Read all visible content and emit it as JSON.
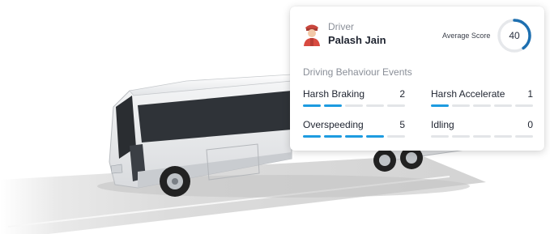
{
  "driver": {
    "label": "Driver",
    "name": "Palash Jain",
    "avatar_icon": "driver-avatar-icon"
  },
  "score": {
    "label": "Average Score",
    "value": "40",
    "fraction": 0.4,
    "ring_color": "#1d6fb0"
  },
  "events": {
    "title": "Driving Behaviour Events",
    "items": [
      {
        "label": "Harsh Braking",
        "count": "2",
        "segments_total": 5,
        "segments_active": 2
      },
      {
        "label": "Harsh Accelerate",
        "count": "1",
        "segments_total": 5,
        "segments_active": 1
      },
      {
        "label": "Overspeeding",
        "count": "5",
        "segments_total": 5,
        "segments_active": 4
      },
      {
        "label": "Idling",
        "count": "0",
        "segments_total": 5,
        "segments_active": 0
      }
    ],
    "active_color": "#1d9be0",
    "inactive_color": "#e3e5e8"
  }
}
